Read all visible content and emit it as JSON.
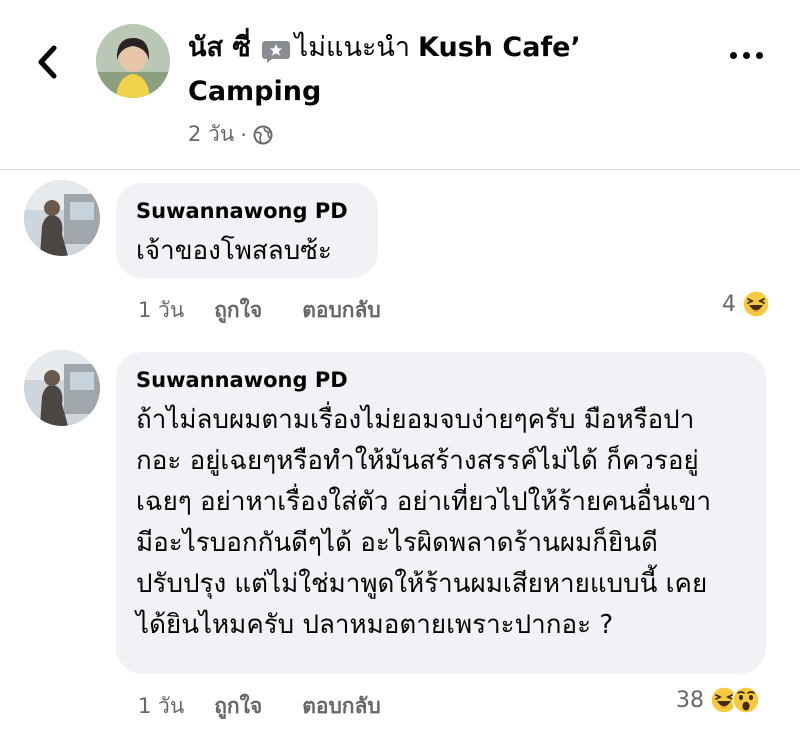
{
  "post": {
    "author": "นัส ซี่",
    "relation": "ไม่แนะนำ",
    "page_line1": "Kush Cafe’",
    "page_line2": "Camping",
    "time": "2 วัน",
    "dot": "·",
    "privacy_icon": "globe-icon"
  },
  "comments": [
    {
      "author": "Suwannawong PD",
      "text": "เจ้าของโพสลบซ้ะ",
      "time": "1 วัน",
      "like_label": "ถูกใจ",
      "reply_label": "ตอบกลับ",
      "reaction_count": "4",
      "reactions": [
        "haha"
      ]
    },
    {
      "author": "Suwannawong PD",
      "text": "ถ้าไม่ลบผมตามเรื่องไม่ยอมจบง่ายๆครับ มือหรือปา\nกอะ อยู่เฉยๆหรือทำให้มันสร้างสรรค์ไม่ได้ ก็ควรอยู่\nเฉยๆ อย่าหาเรื่องใส่ตัว อย่าเที่ยวไปให้ร้ายคนอื่นเขา\nมีอะไรบอกกันดีๆได้ อะไรผิดพลาดร้านผมก็ยินดี\nปรับปรุง แต่ไม่ใช่มาพูดให้ร้านผมเสียหายแบบนี้ เคย\nได้ยินไหมครับ ปลาหมอตายเพราะปากอะ ?",
      "time": "1 วัน",
      "like_label": "ถูกใจ",
      "reply_label": "ตอบกลับ",
      "reaction_count": "38",
      "reactions": [
        "haha",
        "wow"
      ]
    }
  ],
  "colors": {
    "bubble": "#f0f2f5",
    "secondary_text": "#65676b",
    "reaction_yellow": "#f7c93e"
  }
}
